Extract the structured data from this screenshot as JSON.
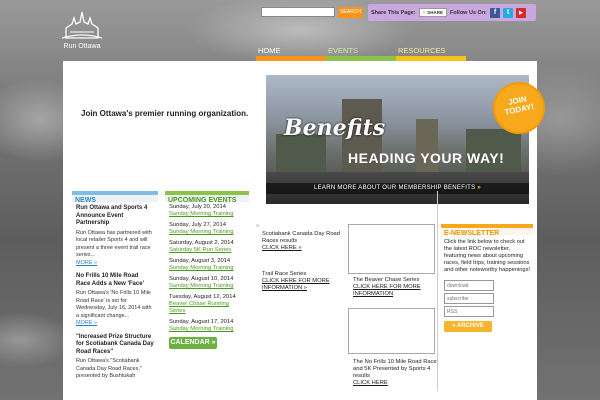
{
  "site": {
    "logo_text": "Run Ottawa",
    "tagline": "Join Ottawa's premier running organization."
  },
  "search": {
    "placeholder": "",
    "button": "SEARCH"
  },
  "share": {
    "share_label": "Share This Page:",
    "share_button": "SHARE",
    "follow_label": "Follow Us On:",
    "facebook": "f",
    "twitter": "t",
    "youtube": "▶"
  },
  "nav": {
    "home": "HOME",
    "events": "EVENTS",
    "resources": "RESOURCES"
  },
  "colors": {
    "home": "#f7941d",
    "events": "#8bc34a",
    "resources": "#f7c21d",
    "accent_blue": "#2a8ac8"
  },
  "hero": {
    "title": "Benefits",
    "subtitle": "HEADING YOUR WAY!",
    "link": "LEARN MORE ABOUT OUR MEMBERSHIP BENEFITS",
    "arrows": "»",
    "badge_line1": "JOIN",
    "badge_line2": "TODAY!"
  },
  "news": {
    "heading": "NEWS",
    "items": [
      {
        "title": "Run Ottawa and Sports 4 Announce Event Partnership",
        "body": "Run Ottawa has partnered with local retailer Sports 4 and will present a three event trail race series...",
        "more": "MORE »"
      },
      {
        "title": "No Frills 10 Mile Road Race Adds a New 'Face'",
        "body": "Run Ottawa's 'No Frills 10 Mile Road Race' is set for Wednesday, July 16, 2014 with a significant change...",
        "more": "MORE »"
      },
      {
        "title": "\"Increased Prize Structure for Scotiabank Canada Day Road Races\"",
        "body": "Run Ottawa's \"Scotiabank Canada Day Road Races,\" presented by Bushtukah",
        "more": ""
      }
    ]
  },
  "events": {
    "heading": "UPCOMING EVENTS",
    "items": [
      {
        "date": "Sunday, July 20, 2014",
        "link": "Sunday Morning Training"
      },
      {
        "date": "Sunday, July 27, 2014",
        "link": "Sunday Morning Training"
      },
      {
        "date": "Saturday, August 2, 2014",
        "link": "Saturday 5K Run Series"
      },
      {
        "date": "Sunday, August 3, 2014",
        "link": "Sunday Morning Training"
      },
      {
        "date": "Sunday, August 10, 2014",
        "link": "Sunday Morning Training"
      },
      {
        "date": "Tuesday, August 12, 2014",
        "link": "Beaver Chase Running Series"
      },
      {
        "date": "Sunday, August 17, 2014",
        "link": "Sunday Morning Training"
      }
    ],
    "calendar_button": "CALENDAR »"
  },
  "middle": {
    "bullet": "»",
    "item1_text": "Scotiabank Canada Day Road Races results",
    "item1_link": "CLICK HERE »",
    "item2_text": "Trail Race Series",
    "item2_link": "CLICK HERE FOR MORE INFORMATION »",
    "item3_text": "The Beaver Chase Series",
    "item3_link": "CLICK HERE FOR MORE INFORMATION",
    "item4_text": "The No Frills 10 Mile Road Race and 5K Presented by Sports 4 results",
    "item4_link": "CLICK HERE"
  },
  "enewsletter": {
    "heading": "E-NEWSLETTER",
    "text": "Click the link below to check out the latest ROC newsletter, featuring news about upcoming races, field trips, training sessions and other noteworthy happenings!",
    "download": "download",
    "subscribe": "subscribe",
    "rss": "RSS",
    "archive_button": "« ARCHIVE"
  }
}
